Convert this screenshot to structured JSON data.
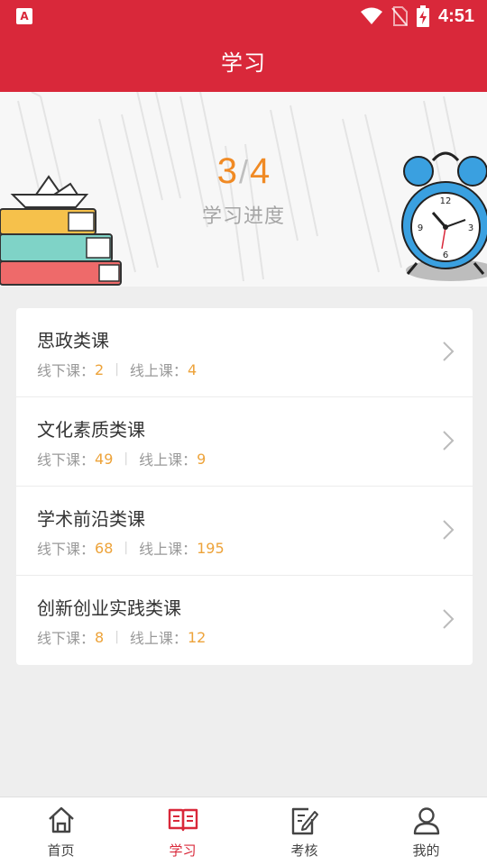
{
  "status_bar": {
    "time": "4:51",
    "app_icon_glyph": "A"
  },
  "header": {
    "title": "学习"
  },
  "banner": {
    "completed": "3",
    "separator": "/",
    "total": "4",
    "label": "学习进度"
  },
  "courses": [
    {
      "title": "思政类课",
      "offline_label": "线下课：",
      "offline": "2",
      "online_label": "线上课：",
      "online": "4"
    },
    {
      "title": "文化素质类课",
      "offline_label": "线下课：",
      "offline": "49",
      "online_label": "线上课：",
      "online": "9"
    },
    {
      "title": "学术前沿类课",
      "offline_label": "线下课：",
      "offline": "68",
      "online_label": "线上课：",
      "online": "195"
    },
    {
      "title": "创新创业实践类课",
      "offline_label": "线下课：",
      "offline": "8",
      "online_label": "线上课：",
      "online": "12"
    }
  ],
  "nav": {
    "items": [
      {
        "label": "首页",
        "icon": "home-icon"
      },
      {
        "label": "学习",
        "icon": "book-icon",
        "active": true
      },
      {
        "label": "考核",
        "icon": "edit-document-icon"
      },
      {
        "label": "我的",
        "icon": "user-icon"
      }
    ]
  },
  "colors": {
    "brand": "#d9283a",
    "accent": "#f08a24",
    "count": "#eda33a"
  }
}
